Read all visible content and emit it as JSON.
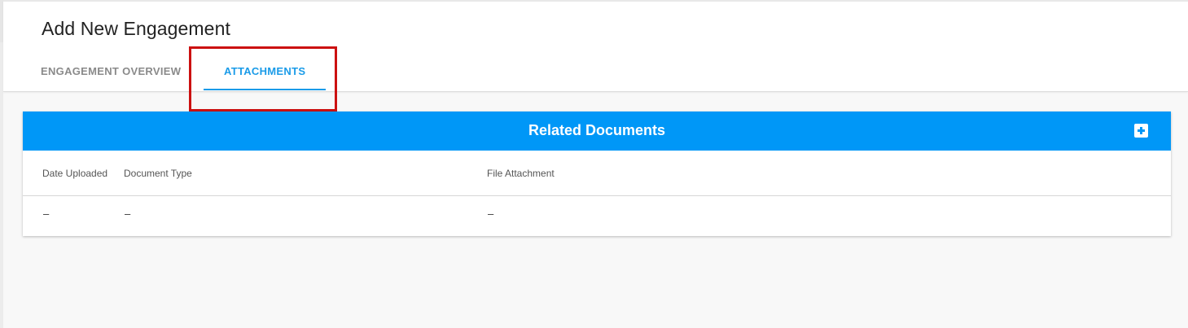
{
  "page": {
    "title": "Add New Engagement"
  },
  "tabs": [
    {
      "label": "ENGAGEMENT OVERVIEW",
      "active": false
    },
    {
      "label": "ATTACHMENTS",
      "active": true
    }
  ],
  "related_documents": {
    "title": "Related Documents",
    "add_icon": "plus-square-icon",
    "columns": [
      "Date Uploaded",
      "Document Type",
      "File Attachment"
    ],
    "rows": [
      [
        "–",
        "–",
        "–"
      ]
    ]
  },
  "colors": {
    "accent": "#0097f7",
    "active_tab": "#1a9be8",
    "inactive_tab": "#8a8a8a",
    "highlight": "#cc1111"
  }
}
